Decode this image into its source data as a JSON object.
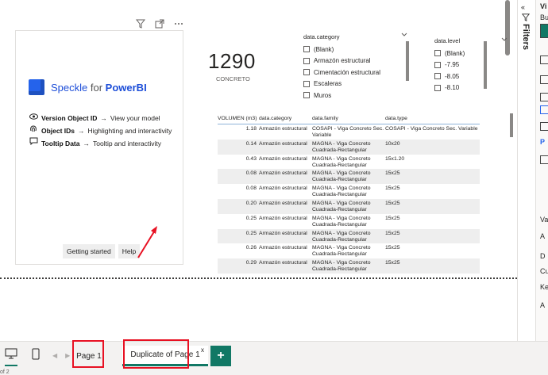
{
  "canvas": {
    "visual_header_icons": [
      "filter-icon",
      "focus-mode-icon",
      "more-options-icon"
    ]
  },
  "speckle": {
    "brand_name": "Speckle",
    "brand_for": "for",
    "brand_product": "PowerBI",
    "features": [
      {
        "icon": "eye-icon",
        "name": "Version Object ID",
        "arrow": "→",
        "desc": "View your model"
      },
      {
        "icon": "fingerprint-icon",
        "name": "Object IDs",
        "arrow": "→",
        "desc": "Highlighting and interactivity"
      },
      {
        "icon": "comment-icon",
        "name": "Tooltip Data",
        "arrow": "→",
        "desc": "Tooltip and interactivity"
      }
    ],
    "getting_started_label": "Getting started",
    "help_label": "Help",
    "brand_color": "#2563eb"
  },
  "kpi": {
    "value": "1290",
    "label": "CONCRETO"
  },
  "slicer_category": {
    "title": "data.category",
    "items": [
      "(Blank)",
      "Armazón estructural",
      "Cimentación estructural",
      "Escaleras",
      "Muros"
    ]
  },
  "slicer_level": {
    "title": "data.level",
    "items": [
      "(Blank)",
      "-7.95",
      "-8.05",
      "-8.10"
    ]
  },
  "table": {
    "headers": [
      "VOLUMEN (m3)",
      "data.category",
      "data.family",
      "data.type"
    ],
    "rows": [
      [
        "1.18",
        "Armazón estructural",
        "COSAPI - Viga Concreto Sec. Variable",
        "COSAPI - Viga Concreto Sec. Variable"
      ],
      [
        "0.14",
        "Armazón estructural",
        "MAGNA - Viga Concreto Cuadrada-Rectangular",
        "10x20"
      ],
      [
        "0.43",
        "Armazón estructural",
        "MAGNA - Viga Concreto Cuadrada-Rectangular",
        "15x1.20"
      ],
      [
        "0.08",
        "Armazón estructural",
        "MAGNA - Viga Concreto Cuadrada-Rectangular",
        "15x25"
      ],
      [
        "0.08",
        "Armazón estructural",
        "MAGNA - Viga Concreto Cuadrada-Rectangular",
        "15x25"
      ],
      [
        "0.20",
        "Armazón estructural",
        "MAGNA - Viga Concreto Cuadrada-Rectangular",
        "15x25"
      ],
      [
        "0.25",
        "Armazón estructural",
        "MAGNA - Viga Concreto Cuadrada-Rectangular",
        "15x25"
      ],
      [
        "0.25",
        "Armazón estructural",
        "MAGNA - Viga Concreto Cuadrada-Rectangular",
        "15x25"
      ],
      [
        "0.26",
        "Armazón estructural",
        "MAGNA - Viga Concreto Cuadrada-Rectangular",
        "15x25"
      ],
      [
        "0.29",
        "Armazón estructural",
        "MAGNA - Viga Concreto Cuadrada-Rectangular",
        "15x25"
      ]
    ]
  },
  "right_panel": {
    "filters_label": "Filters",
    "viz_partial": [
      "Vi",
      "Bu",
      "P",
      "Va",
      "A",
      "D",
      "Cu",
      "Ke",
      "A"
    ]
  },
  "tabs": {
    "page1_label": "Page 1",
    "duplicate_label": "Duplicate of Page 1",
    "close_label": "x",
    "add_label": "+",
    "active_color": "#117865"
  },
  "status": {
    "page_info": "of 2"
  },
  "highlight_color": "#e81123"
}
